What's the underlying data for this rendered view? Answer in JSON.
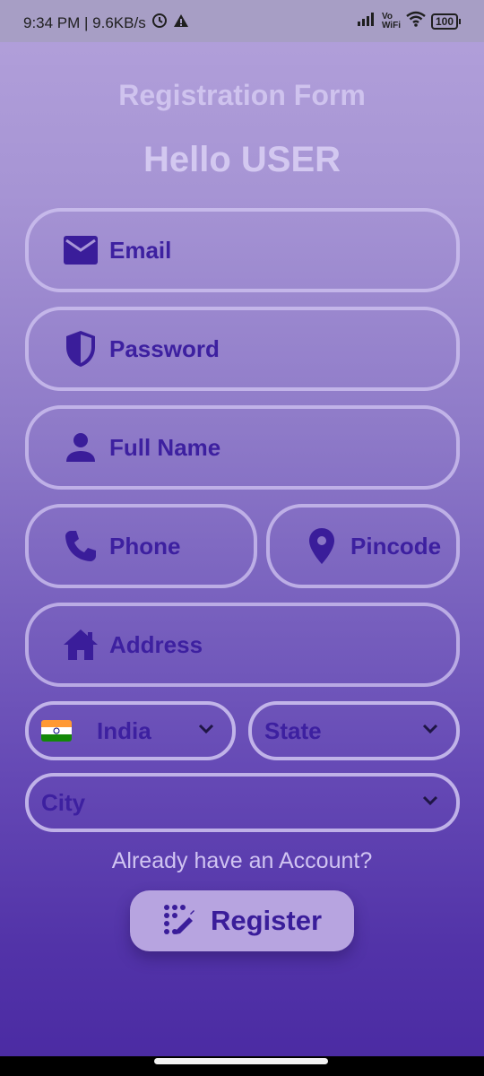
{
  "status_bar": {
    "time_speed": "9:34 PM | 9.6KB/s",
    "vo_wifi_top": "Vo",
    "vo_wifi_bottom": "WiFi",
    "battery": "100"
  },
  "form": {
    "heading": "Registration Form",
    "greeting": "Hello USER",
    "email_label": "Email",
    "password_label": "Password",
    "fullname_label": "Full Name",
    "phone_label": "Phone",
    "pincode_label": "Pincode",
    "address_label": "Address",
    "country_value": "India",
    "state_placeholder": "State",
    "city_placeholder": "City",
    "account_link": "Already have an Account?",
    "register_label": "Register"
  },
  "colors": {
    "accent": "#3d20a0",
    "border": "#d2c6f2",
    "button_bg": "#b7a4e0"
  },
  "icons": [
    "mail-icon",
    "shield-icon",
    "person-icon",
    "phone-icon",
    "location-pin-icon",
    "home-icon",
    "india-flag-icon",
    "chevron-down-icon",
    "magic-wand-icon"
  ]
}
